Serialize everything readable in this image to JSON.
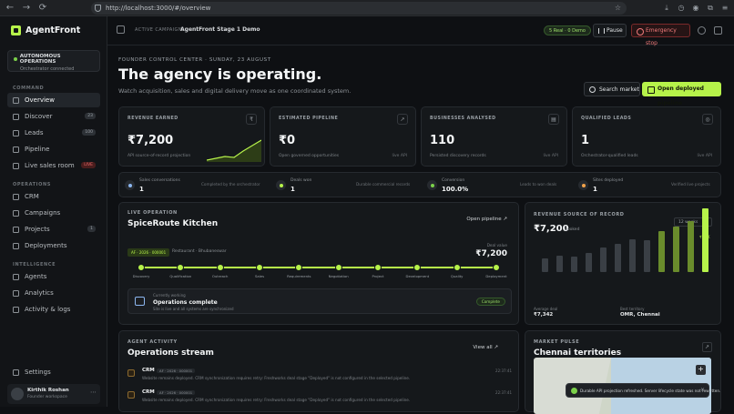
{
  "browser": {
    "url": "http://localhost:3000/#/overview"
  },
  "sidebar": {
    "logo": "AgentFront",
    "auto_title": "AUTONOMOUS OPERATIONS",
    "auto_sub": "Orchestrator connected",
    "sec_command": "COMMAND",
    "sec_operations": "OPERATIONS",
    "sec_intelligence": "INTELLIGENCE",
    "items": [
      {
        "label": "Overview"
      },
      {
        "label": "Discover",
        "badge": "23"
      },
      {
        "label": "Leads",
        "badge": "100"
      },
      {
        "label": "Pipeline"
      },
      {
        "label": "Live sales room",
        "badge": "LIVE"
      },
      {
        "label": "CRM"
      },
      {
        "label": "Campaigns"
      },
      {
        "label": "Projects",
        "badge": "1"
      },
      {
        "label": "Deployments"
      },
      {
        "label": "Agents"
      },
      {
        "label": "Analytics"
      },
      {
        "label": "Activity & logs"
      },
      {
        "label": "Settings"
      }
    ],
    "user": {
      "name": "Kirthik Roshan",
      "role": "Founder workspace"
    }
  },
  "topbar": {
    "crumb1": "ACTIVE CAMPAIGN",
    "crumb2": "AgentFront Stage 1 Demo",
    "real_pill": "5 Real · 0 Demo",
    "pause": "Pause",
    "emergency": "Emergency stop"
  },
  "header": {
    "eyebrow": "FOUNDER CONTROL CENTER · SUNDAY, 23 AUGUST",
    "title": "The agency is operating.",
    "subtitle": "Watch acquisition, sales and digital delivery move as one coordinated system.",
    "search": "Search market",
    "open": "Open deployed pipeline"
  },
  "kpis": [
    {
      "label": "REVENUE EARNED",
      "value": "₹7,200",
      "sub": "API source-of-record projection",
      "icon": "₹"
    },
    {
      "label": "ESTIMATED PIPELINE",
      "value": "₹0",
      "sub": "Open governed opportunities",
      "right": "live API",
      "icon": "↗"
    },
    {
      "label": "BUSINESSES ANALYSED",
      "value": "110",
      "sub": "Persisted discovery records",
      "right": "live API",
      "icon": "▤"
    },
    {
      "label": "QUALIFIED LEADS",
      "value": "1",
      "sub": "Orchestrator-qualified leads",
      "right": "live API",
      "icon": "◎"
    }
  ],
  "stats": [
    {
      "label": "Sales conversations",
      "value": "1",
      "note": "Completed by the orchestrator",
      "color": "#8cb7f0"
    },
    {
      "label": "Deals won",
      "value": "1",
      "note": "Durable commercial records",
      "color": "#b6f24a"
    },
    {
      "label": "Conversion",
      "value": "100.0%",
      "note": "Leads to won deals",
      "color": "#7bd14a"
    },
    {
      "label": "Sites deployed",
      "value": "1",
      "note": "Verified live projects",
      "color": "#f0a24a"
    }
  ],
  "live_op": {
    "eyebrow": "LIVE OPERATION",
    "title": "SpiceRoute Kitchen",
    "open_link": "Open pipeline ↗",
    "tag": "AF · 2026 · 000001",
    "sub": "Restaurant · Bhubaneswar",
    "deal_label": "Deal value",
    "deal_value": "₹7,200",
    "stages": [
      "Discovery",
      "Qualification",
      "Outreach",
      "Sales",
      "Requirements",
      "Negotiation",
      "Project",
      "Development",
      "Quality",
      "Deployment"
    ],
    "cw_label": "Currently working",
    "cw_title": "Operations complete",
    "cw_sub": "Site is live and all systems are synchronized",
    "cw_badge": "Complete"
  },
  "revenue": {
    "eyebrow": "REVENUE SOURCE OF RECORD",
    "value": "₹7,200",
    "unit": "booked",
    "select": "12 weeks",
    "foot_l_label": "Average deal",
    "foot_l_value": "₹7,342",
    "foot_r_label": "Best territory",
    "foot_r_value": "OMR, Chennai",
    "top_label": "₹7.2K"
  },
  "chart_data": {
    "type": "bar",
    "categories": [
      "1",
      "2",
      "3",
      "4",
      "5",
      "6",
      "7",
      "8",
      "9",
      "10",
      "11",
      "12"
    ],
    "values": [
      22,
      26,
      24,
      30,
      38,
      44,
      52,
      50,
      64,
      72,
      80,
      100
    ],
    "ylim": [
      0,
      100
    ],
    "highlight_last": true
  },
  "activity": {
    "eyebrow": "AGENT ACTIVITY",
    "title": "Operations stream",
    "view_all": "View all ↗",
    "items": [
      {
        "title": "CRM",
        "tag": "AF · 2026 · 000001",
        "msg": "Website remains deployed. CRM synchronization requires retry: Freshworks deal stage \"Deployed\" is not configured in the selected pipeline.",
        "time": "22:37:41"
      },
      {
        "title": "CRM",
        "tag": "AF · 2026 · 000001",
        "msg": "Website remains deployed. CRM synchronization requires retry: Freshworks deal stage \"Deployed\" is not configured in the selected pipeline.",
        "time": "22:37:41"
      }
    ]
  },
  "market": {
    "eyebrow": "MARKET PULSE",
    "title": "Chennai territories"
  },
  "toast": {
    "text": "Durable API projection refreshed. Server lifecycle state was not rewritten."
  }
}
